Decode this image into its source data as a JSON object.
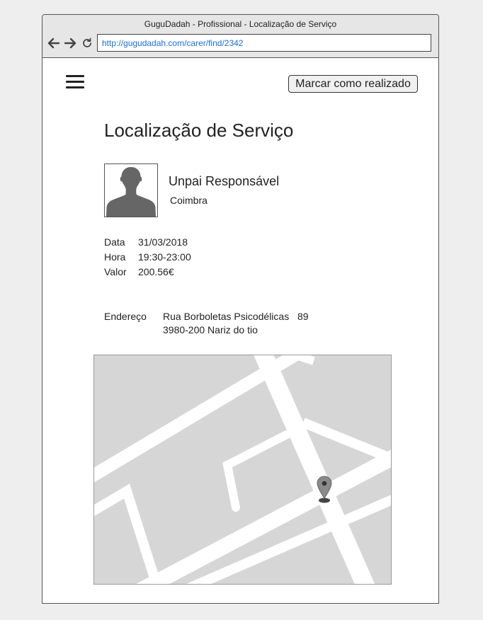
{
  "window": {
    "title": "GuguDadah - Profissional - Localização de Serviço",
    "url": "http://gugudadah.com/carer/find/2342",
    "icons": [
      "back-arrow-icon",
      "forward-arrow-icon",
      "reload-icon"
    ]
  },
  "header": {
    "menu_icon": "hamburger-menu-icon",
    "mark_done_label": "Marcar como realizado"
  },
  "page": {
    "title": "Localização de Serviço"
  },
  "person": {
    "name": "Unpai Responsável",
    "city": "Coimbra",
    "avatar_icon": "person-silhouette-icon"
  },
  "details": [
    {
      "label": "Data",
      "value": "31/03/2018"
    },
    {
      "label": "Hora",
      "value": "19:30-23:00"
    },
    {
      "label": "Valor",
      "value": "200.56€"
    }
  ],
  "address": {
    "label": "Endereço",
    "street": "Rua Borboletas Psicodélicas",
    "number": "89",
    "postal": "3980-200 Nariz do tio"
  },
  "map": {
    "marker_icon": "map-pin-icon",
    "colors": {
      "background": "#d6d6d6",
      "roads": "#ffffff",
      "marker": "#888888"
    }
  }
}
